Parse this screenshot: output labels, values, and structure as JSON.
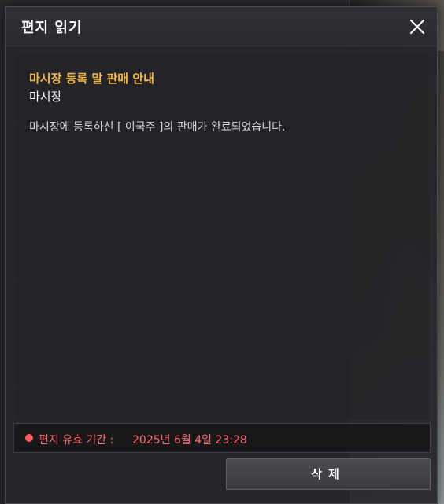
{
  "dialog": {
    "title": "편지 읽기",
    "close_icon": "close-icon"
  },
  "letter": {
    "subject": "마시장 등록 말 판매 안내",
    "sender": "마시장",
    "body": "마시장에 등록하신 [ 이국주 ]의 판매가 완료되었습니다."
  },
  "expiry": {
    "label": "편지 유효 기간 :",
    "value": "2025년 6월 4일 23:28",
    "color": "#ff6b6b"
  },
  "actions": {
    "delete_label": "삭제"
  },
  "colors": {
    "subject": "#f2b84b",
    "title": "#ffffff",
    "warning_dot": "#ff5a5a"
  }
}
